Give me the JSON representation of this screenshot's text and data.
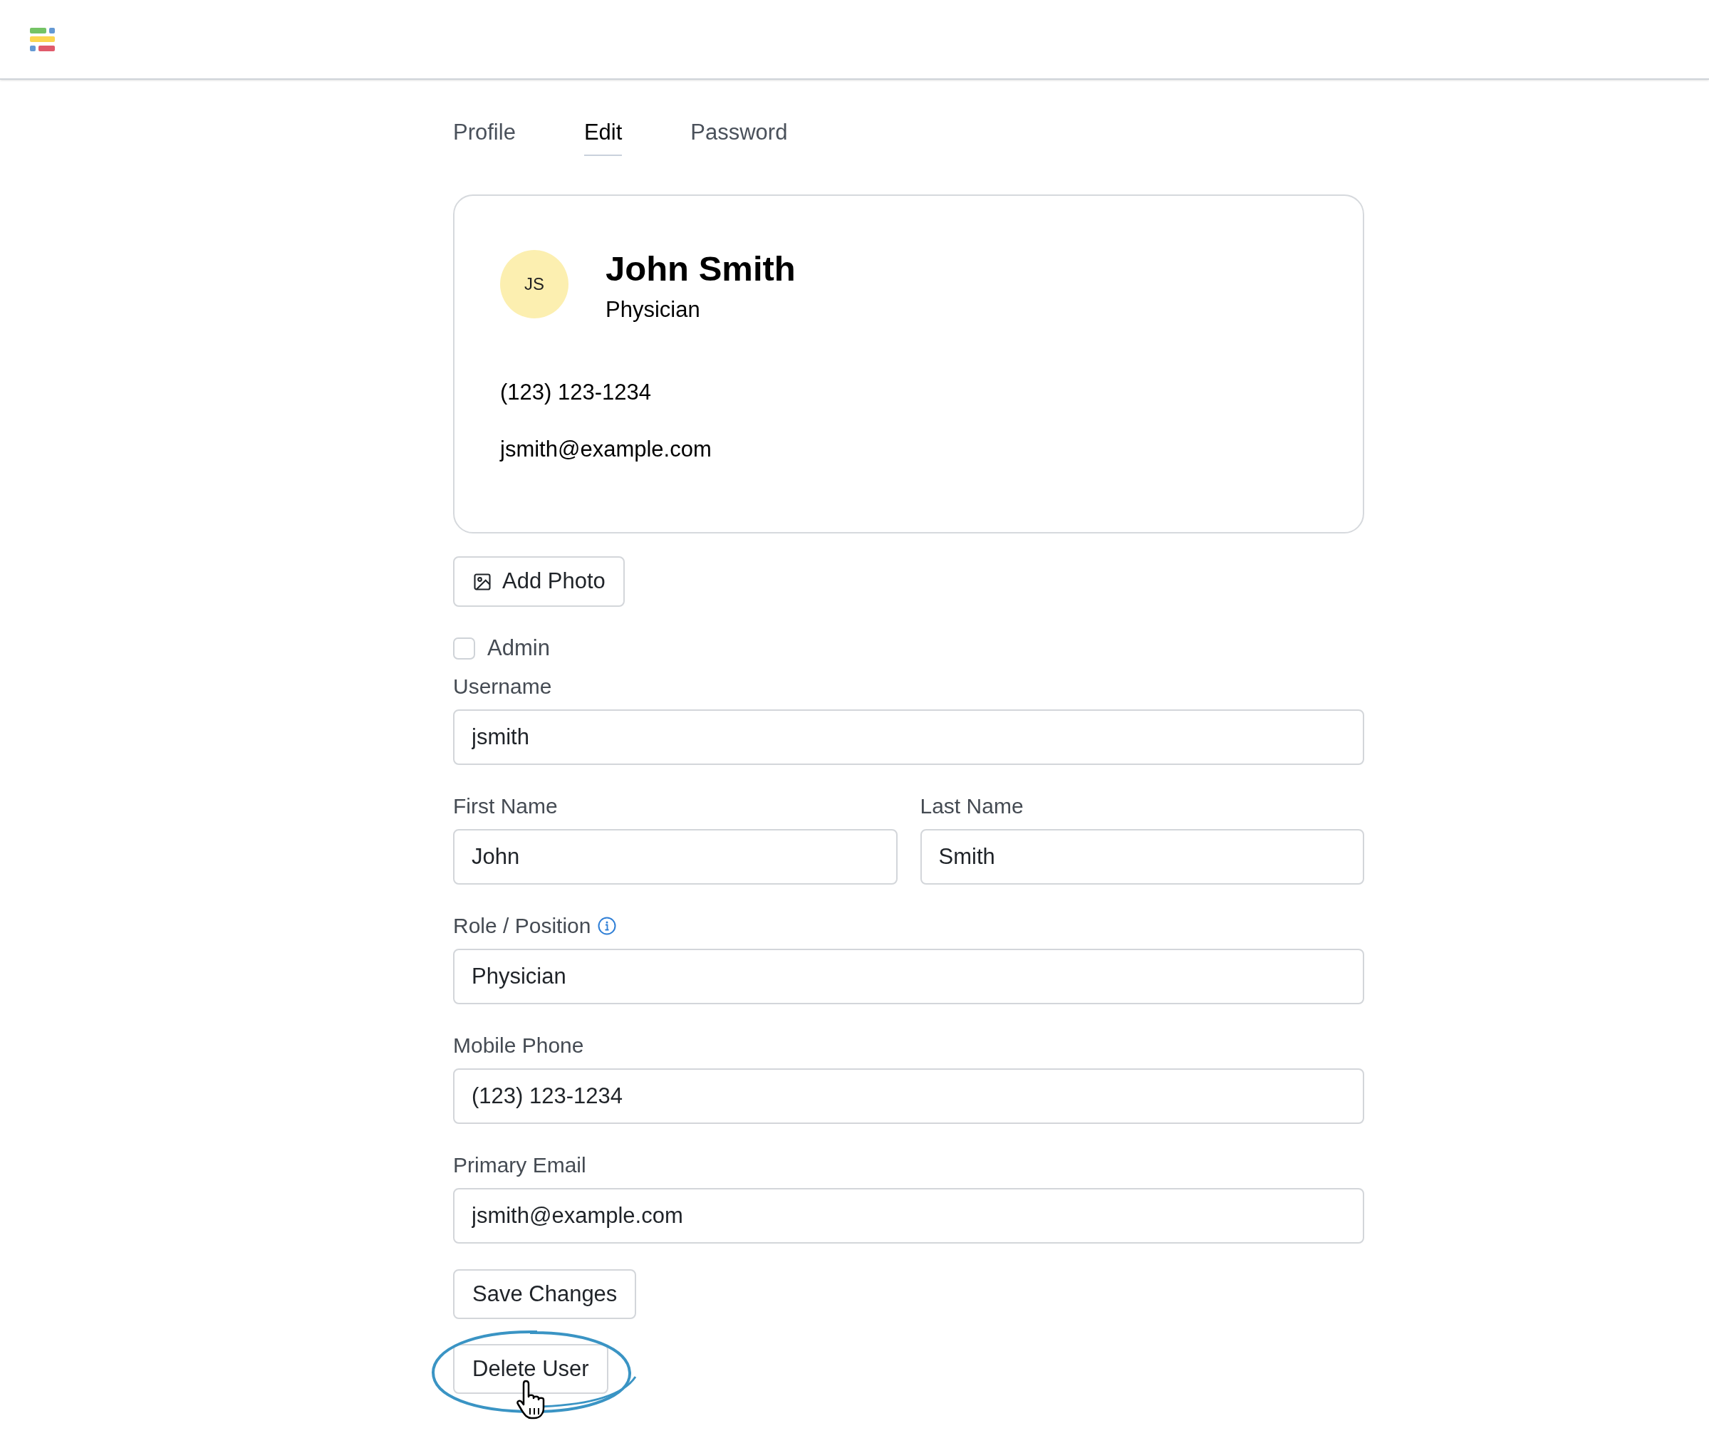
{
  "tabs": [
    {
      "label": "Profile",
      "selected": false
    },
    {
      "label": "Edit",
      "selected": true
    },
    {
      "label": "Password",
      "selected": false
    }
  ],
  "profile_card": {
    "initials": "JS",
    "name": "John Smith",
    "role": "Physician",
    "phone": "(123) 123-1234",
    "email": "jsmith@example.com"
  },
  "add_photo_button": "Add Photo",
  "admin": {
    "label": "Admin",
    "checked": false
  },
  "form_rows": [
    [
      {
        "label": "Username",
        "value": "jsmith",
        "info": false
      }
    ],
    [
      {
        "label": "First Name",
        "value": "John",
        "info": false
      },
      {
        "label": "Last Name",
        "value": "Smith",
        "info": false
      }
    ],
    [
      {
        "label": "Role / Position",
        "value": "Physician",
        "info": true
      }
    ],
    [
      {
        "label": "Mobile Phone",
        "value": "(123) 123-1234",
        "info": false
      }
    ],
    [
      {
        "label": "Primary Email",
        "value": "jsmith@example.com",
        "info": false
      }
    ]
  ],
  "buttons": [
    {
      "label": "Save Changes",
      "highlighted": false
    },
    {
      "label": "Delete User",
      "highlighted": true
    }
  ]
}
